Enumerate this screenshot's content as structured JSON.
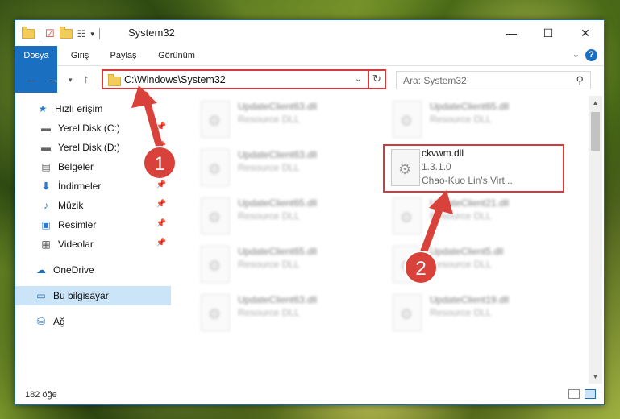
{
  "window": {
    "title": "System32",
    "controls": {
      "minimize": "—",
      "maximize": "☐",
      "close": "✕"
    }
  },
  "ribbon": {
    "tabs": [
      "Dosya",
      "Giriş",
      "Paylaş",
      "Görünüm"
    ],
    "help": "?"
  },
  "navbar": {
    "address": "C:\\Windows\\System32",
    "search_placeholder": "Ara: System32"
  },
  "nav_pane": {
    "items": [
      {
        "label": "Hızlı erişim",
        "icon": "star-icon"
      },
      {
        "label": "Yerel Disk (C:)",
        "icon": "drive-icon"
      },
      {
        "label": "Yerel Disk (D:)",
        "icon": "drive-icon"
      },
      {
        "label": "Belgeler",
        "icon": "documents-icon"
      },
      {
        "label": "İndirmeler",
        "icon": "download-icon"
      },
      {
        "label": "Müzik",
        "icon": "music-icon"
      },
      {
        "label": "Resimler",
        "icon": "pictures-icon"
      },
      {
        "label": "Videolar",
        "icon": "videos-icon"
      },
      {
        "label": "OneDrive",
        "icon": "cloud-icon"
      },
      {
        "label": "Bu bilgisayar",
        "icon": "computer-icon"
      },
      {
        "label": "Ağ",
        "icon": "network-icon"
      }
    ]
  },
  "files": {
    "left": [
      {
        "name": "UpdateClient63.dll",
        "type": "Resource DLL"
      },
      {
        "name": "UpdateClient63.dll",
        "type": "Resource DLL"
      },
      {
        "name": "UpdateClient65.dll",
        "type": "Resource DLL"
      },
      {
        "name": "UpdateClient65.dll",
        "type": "Resource DLL"
      },
      {
        "name": "UpdateClient63.dll",
        "type": "Resource DLL"
      }
    ],
    "right": [
      {
        "name": "UpdateClient65.dll",
        "type": "Resource DLL"
      },
      {
        "name": "ckvwm.dll",
        "version": "1.3.1.0",
        "company": "Chao-Kuo Lin's Virt..."
      },
      {
        "name": "UpdateClient21.dll",
        "type": "Resource DLL"
      },
      {
        "name": "UpdateClient5.dll",
        "type": "Resource DLL"
      },
      {
        "name": "UpdateClient19.dll",
        "type": "Resource DLL"
      }
    ]
  },
  "status": {
    "count": "182 öğe"
  },
  "annotations": {
    "badge1": "1",
    "badge2": "2",
    "color": "#d9413b"
  }
}
